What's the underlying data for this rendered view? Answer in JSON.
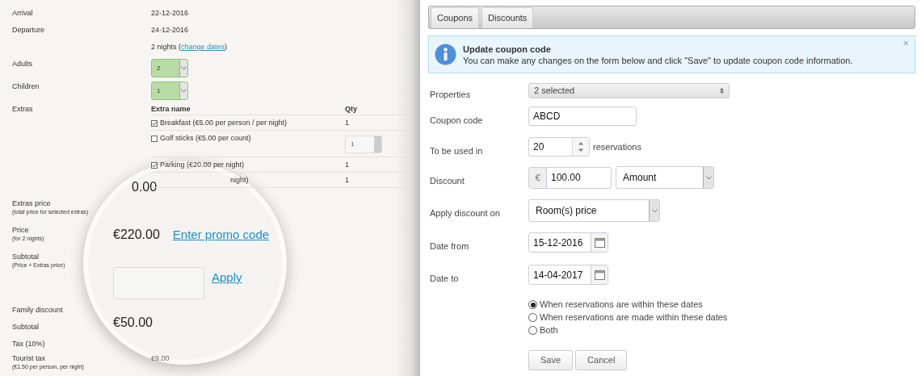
{
  "booking": {
    "rows": [
      {
        "kind": "text",
        "label": "Arrival",
        "value": "22-12-2016"
      },
      {
        "kind": "text",
        "label": "Departure",
        "value": "24-12-2016"
      },
      {
        "kind": "nights",
        "prefix": "2 nights (",
        "link": "change dates",
        "suffix": ")"
      },
      {
        "kind": "select",
        "label": "Adults",
        "value": "2"
      },
      {
        "kind": "select",
        "label": "Children",
        "value": "1"
      },
      {
        "kind": "extras",
        "label": "Extras"
      },
      {
        "kind": "note",
        "label": "Extras price",
        "note": "(total price for selected extras)"
      },
      {
        "kind": "note",
        "label": "Price",
        "note": "(for 2 nights)"
      },
      {
        "kind": "note",
        "label": "Subtotal",
        "note": "(Price + Extras price)"
      },
      {
        "kind": "gap"
      },
      {
        "kind": "text",
        "label": "Family discount"
      },
      {
        "kind": "text",
        "label": "Subtotal"
      },
      {
        "kind": "text",
        "label": "Tax (10%)"
      },
      {
        "kind": "note",
        "label": "Tourist tax",
        "note": "(€1.50 per person, per night)",
        "value": "€9.00"
      }
    ],
    "extras": {
      "columns": [
        "Extra name",
        "Qty"
      ],
      "items": [
        {
          "kind": "checkbox",
          "name": "Breakfast (€5.00 per person / per night)",
          "checked": true,
          "qty": "1"
        },
        {
          "kind": "checkbox-select",
          "name": "Golf sticks (€5.00 per count)",
          "checked": false,
          "qty": "1"
        },
        {
          "kind": "checkbox",
          "name": "Parking (€20.00 per night)",
          "checked": true,
          "qty": "1"
        },
        {
          "kind": "covered",
          "name": "night)",
          "qty": "1"
        }
      ]
    }
  },
  "magnifier": {
    "extras_price": "0.00",
    "price": "€220.00",
    "promo_link": "Enter promo code",
    "apply_link": "Apply",
    "subtotal": "€50.00"
  },
  "coupon_panel": {
    "tabs": [
      {
        "label": "Coupons"
      },
      {
        "label": "Discounts"
      }
    ],
    "alert": {
      "title": "Update coupon code",
      "message": "You can make any changes on the form below and click \"Save\" to update coupon code information.",
      "close": "×"
    },
    "fields": [
      {
        "kind": "multiselect",
        "label": "Properties",
        "value": "2 selected"
      },
      {
        "kind": "input",
        "label": "Coupon code",
        "value": "ABCD"
      },
      {
        "kind": "spinner",
        "label": "To be used in",
        "value": "20",
        "suffix": "reservations"
      },
      {
        "kind": "money",
        "label": "Discount",
        "addon": "€",
        "value": "100.00",
        "type": "Amount"
      },
      {
        "kind": "select",
        "label": "Apply discount on",
        "value": "Room(s) price"
      },
      {
        "kind": "date",
        "label": "Date from",
        "value": "15-12-2016"
      },
      {
        "kind": "date",
        "label": "Date to",
        "value": "14-04-2017"
      }
    ],
    "radios": [
      {
        "label": "When reservations are within these dates",
        "selected": true
      },
      {
        "label": "When reservations are made within these dates",
        "selected": false
      },
      {
        "label": "Both",
        "selected": false
      }
    ],
    "buttons": [
      "Save",
      "Cancel"
    ]
  }
}
